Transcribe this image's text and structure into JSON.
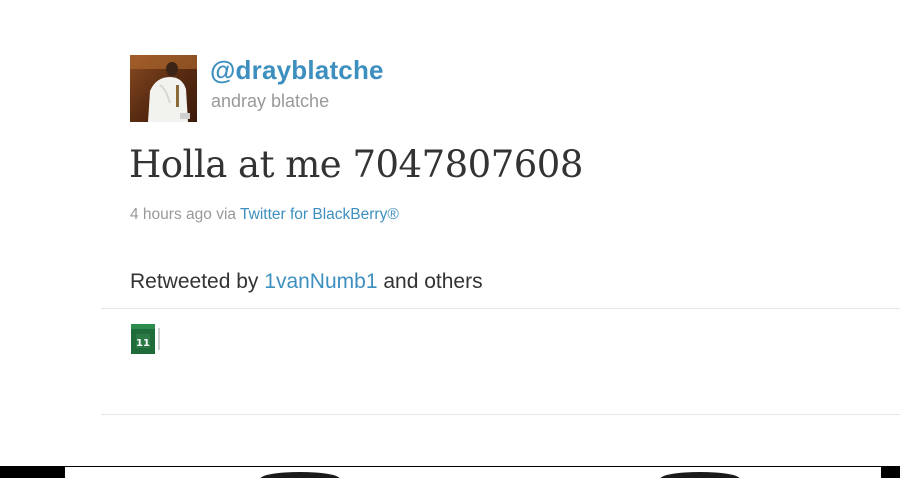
{
  "tweet": {
    "screen_name": "@drayblatche",
    "full_name": "andray blatche",
    "text": "Holla at me 7047807608",
    "timestamp": "4 hours ago",
    "via_label": "via",
    "source": "Twitter for BlackBerry®"
  },
  "retweets": {
    "prefix": "Retweeted by",
    "user": "1vanNumb1",
    "suffix": "and others",
    "avatar_jersey_number": "11"
  },
  "colors": {
    "link": "#3d8fbf",
    "muted": "#999999",
    "text": "#333333",
    "divider": "#e6e6e6"
  },
  "icons": {
    "avatar": "user-photo",
    "retweeter_avatar": "jersey-photo"
  }
}
